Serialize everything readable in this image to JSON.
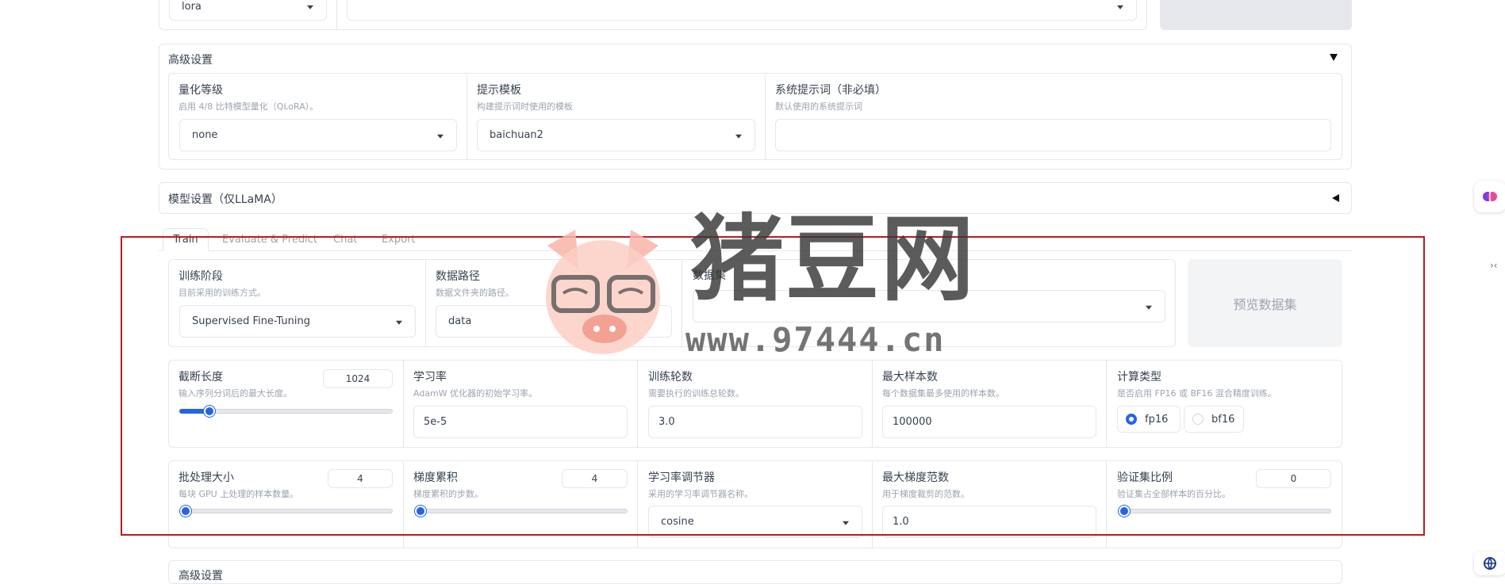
{
  "top_row": {
    "finetune_value": "lora"
  },
  "advanced": {
    "title": "高级设置",
    "quant": {
      "label": "量化等级",
      "info": "启用 4/8 比特模型量化（QLoRA）。",
      "value": "none"
    },
    "template": {
      "label": "提示模板",
      "info": "构建提示词时使用的模板",
      "value": "baichuan2"
    },
    "system": {
      "label": "系统提示词（非必填）",
      "info": "默认使用的系统提示词",
      "value": ""
    }
  },
  "model_settings": {
    "title": "模型设置（仅LLaMA）"
  },
  "tabs": [
    "Train",
    "Evaluate & Predict",
    "Chat",
    "Export"
  ],
  "train": {
    "stage": {
      "label": "训练阶段",
      "info": "目前采用的训练方式。",
      "value": "Supervised Fine-Tuning"
    },
    "data_dir": {
      "label": "数据路径",
      "info": "数据文件夹的路径。",
      "value": "data"
    },
    "dataset": {
      "label": "数据集",
      "value": ""
    },
    "preview_button": "预览数据集",
    "cutoff": {
      "label": "截断长度",
      "info": "输入序列分词后的最大长度。",
      "value": "1024",
      "fraction": 0.12
    },
    "lr": {
      "label": "学习率",
      "info": "AdamW 优化器的初始学习率。",
      "value": "5e-5"
    },
    "epochs": {
      "label": "训练轮数",
      "info": "需要执行的训练总轮数。",
      "value": "3.0"
    },
    "max_samples": {
      "label": "最大样本数",
      "info": "每个数据集最多使用的样本数。",
      "value": "100000"
    },
    "compute": {
      "label": "计算类型",
      "info": "是否启用 FP16 或 BF16 混合精度训练。",
      "options": [
        "fp16",
        "bf16"
      ],
      "selected": "fp16"
    },
    "batch": {
      "label": "批处理大小",
      "info": "每块 GPU 上处理的样本数量。",
      "value": "4",
      "fraction": 0.0
    },
    "grad_acc": {
      "label": "梯度累积",
      "info": "梯度累积的步数。",
      "value": "4",
      "fraction": 0.0
    },
    "scheduler": {
      "label": "学习率调节器",
      "info": "采用的学习率调节器名称。",
      "value": "cosine"
    },
    "max_grad": {
      "label": "最大梯度范数",
      "info": "用于梯度裁剪的范数。",
      "value": "1.0"
    },
    "val_size": {
      "label": "验证集比例",
      "info": "验证集占全部样本的百分比。",
      "value": "0",
      "fraction": 0.0
    }
  },
  "lower": {
    "title": "高级设置"
  },
  "watermark": {
    "brand": "猪豆网",
    "url": "www.97444.cn"
  },
  "colors": {
    "accent": "#2563eb",
    "highlight_box": "#b91c1c"
  }
}
